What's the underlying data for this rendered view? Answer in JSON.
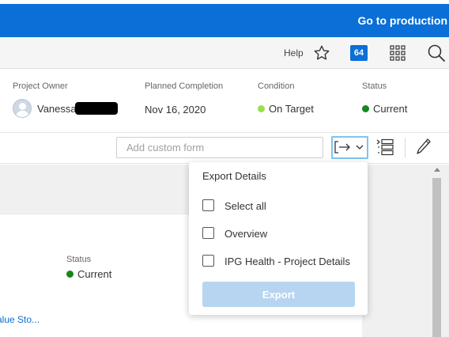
{
  "topbar": {
    "go_production_label": "Go to production",
    "color": "#0a6fd6"
  },
  "utility": {
    "help_label": "Help",
    "notification_count": "64",
    "icons": [
      "star-icon",
      "apps-grid-icon",
      "search-icon"
    ]
  },
  "project": {
    "owner_label": "Project Owner",
    "owner_name": "Vanessa",
    "planned_label": "Planned Completion",
    "planned_value": "Nov 16, 2020",
    "condition_label": "Condition",
    "condition_value": "On Target",
    "condition_color": "#9be04a",
    "status_label": "Status",
    "status_value": "Current",
    "status_color": "#138a1b"
  },
  "toolbar": {
    "custom_form_placeholder": "Add custom form",
    "icons": [
      "export-icon",
      "chevron-down-icon",
      "list-view-icon",
      "pencil-icon"
    ]
  },
  "content": {
    "status_label": "Status",
    "status_value": "Current",
    "link_text": "alue Sto..."
  },
  "export_menu": {
    "title": "Export Details",
    "options": [
      {
        "label": "Select all",
        "checked": false
      },
      {
        "label": "Overview",
        "checked": false
      },
      {
        "label": "IPG Health - Project Details",
        "checked": false
      }
    ],
    "export_button": "Export",
    "export_button_color": "#b7d5f0"
  }
}
